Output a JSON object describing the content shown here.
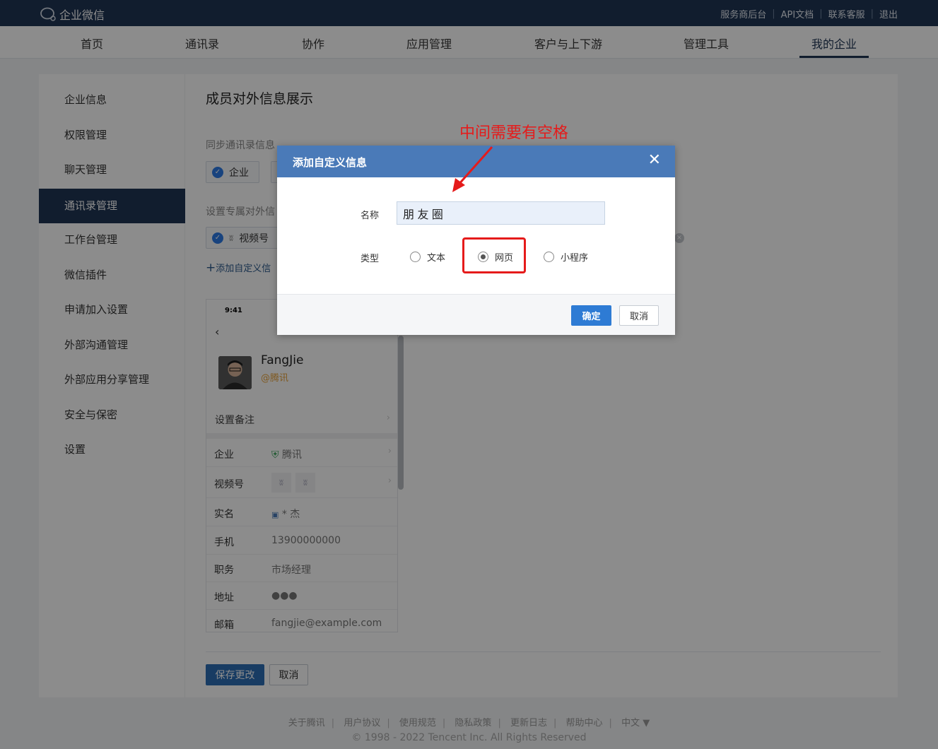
{
  "header": {
    "logo": "企业微信",
    "links": [
      "服务商后台",
      "API文档",
      "联系客服",
      "退出"
    ]
  },
  "nav": {
    "items": [
      "首页",
      "通讯录",
      "协作",
      "应用管理",
      "客户与上下游",
      "管理工具",
      "我的企业"
    ],
    "active": "我的企业"
  },
  "sidebar": {
    "items": [
      "企业信息",
      "权限管理",
      "聊天管理",
      "通讯录管理",
      "工作台管理",
      "微信插件",
      "申请加入设置",
      "外部沟通管理",
      "外部应用分享管理",
      "安全与保密",
      "设置"
    ],
    "active": "通讯录管理"
  },
  "content": {
    "title": "成员对外信息展示",
    "sync_label": "同步通讯录信息",
    "sync_chip": "企业",
    "custom_label": "设置专属对外信",
    "custom_chip": "视频号",
    "add_link": "添加自定义信"
  },
  "preview": {
    "time": "9:41",
    "name": "FangJie",
    "corp": "@腾讯",
    "remark": "设置备注",
    "rows": [
      {
        "key": "企业",
        "value": "腾讯"
      },
      {
        "key": "视频号",
        "value": ""
      },
      {
        "key": "实名",
        "value": "* 杰"
      },
      {
        "key": "手机",
        "value": "13900000000"
      },
      {
        "key": "职务",
        "value": "市场经理"
      },
      {
        "key": "地址",
        "value": "●●●"
      },
      {
        "key": "邮箱",
        "value": "fangjie@example.com"
      }
    ]
  },
  "actions": {
    "save": "保存更改",
    "cancel": "取消"
  },
  "footer": {
    "links": [
      "关于腾讯",
      "用户协议",
      "使用规范",
      "隐私政策",
      "更新日志",
      "帮助中心",
      "中文 ▼"
    ],
    "copyright": "© 1998 - 2022 Tencent Inc. All Rights Reserved"
  },
  "modal": {
    "title": "添加自定义信息",
    "name_label": "名称",
    "name_value": "朋 友 圈",
    "type_label": "类型",
    "options": [
      "文本",
      "网页",
      "小程序"
    ],
    "selected": "网页",
    "ok": "确定",
    "cancel": "取消"
  },
  "annotation": "中间需要有空格",
  "colors": {
    "header": "#1f3554",
    "modal_head": "#4a7ab8",
    "primary": "#2e7bd4",
    "annotation": "#e51b1b"
  }
}
